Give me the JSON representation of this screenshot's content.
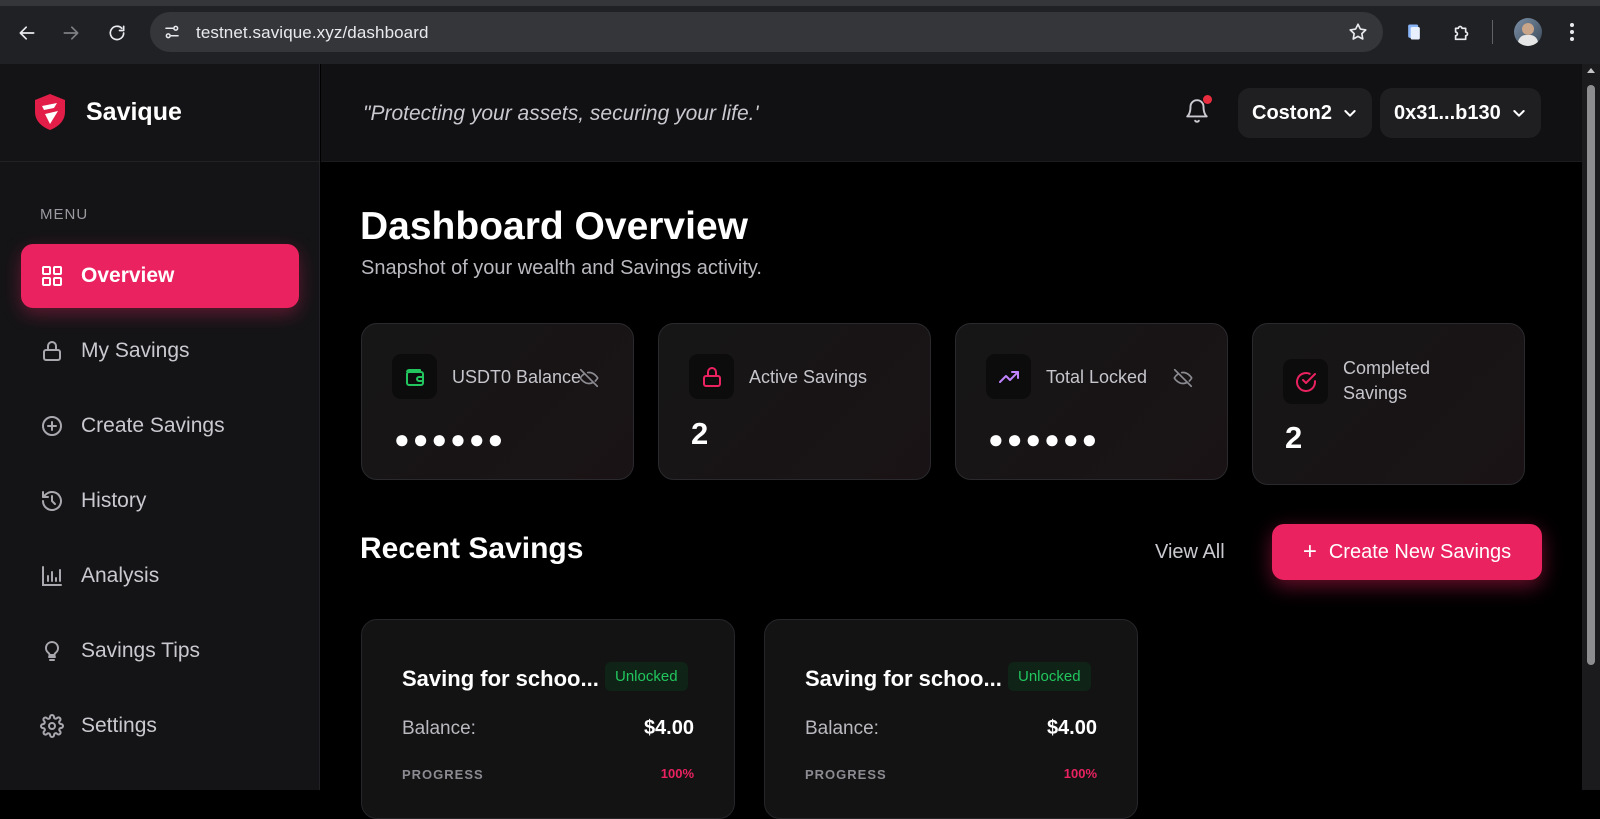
{
  "browser": {
    "url_host": "testnet.savique.xyz",
    "url_path": "/dashboard"
  },
  "brand": {
    "name": "Savique"
  },
  "sidebar": {
    "menu_label": "MENU",
    "items": [
      {
        "label": "Overview",
        "icon": "grid-icon",
        "active": true
      },
      {
        "label": "My Savings",
        "icon": "lock-icon"
      },
      {
        "label": "Create Savings",
        "icon": "plus-circle-icon"
      },
      {
        "label": "History",
        "icon": "history-icon"
      },
      {
        "label": "Analysis",
        "icon": "bar-chart-icon"
      },
      {
        "label": "Savings Tips",
        "icon": "lightbulb-icon"
      },
      {
        "label": "Settings",
        "icon": "gear-icon"
      }
    ]
  },
  "topbar": {
    "tagline": "\"Protecting your assets, securing your life.'",
    "network": "Coston2",
    "wallet": "0x31...b130"
  },
  "main": {
    "title": "Dashboard Overview",
    "subtitle": "Snapshot of your wealth and Savings activity.",
    "stats": [
      {
        "label": "USDT0 Balance",
        "value": "●●●●●●",
        "hidden": true,
        "icon": "wallet-icon",
        "icon_color": "#22c55e"
      },
      {
        "label": "Active Savings",
        "value": "2",
        "icon": "lock-icon",
        "icon_color": "#ea2260"
      },
      {
        "label": "Total Locked",
        "value": "●●●●●●",
        "hidden": true,
        "icon": "trending-up-icon",
        "icon_color": "#c084fc"
      },
      {
        "label_line1": "Completed",
        "label_line2": "Savings",
        "value": "2",
        "icon": "check-circle-icon",
        "icon_color": "#ea2260"
      }
    ],
    "recent": {
      "title": "Recent Savings",
      "view_all": "View All",
      "create_button": "Create New Savings",
      "create_icon": "+",
      "cards": [
        {
          "title": "Saving for schoo...",
          "status": "Unlocked",
          "balance_label": "Balance:",
          "balance": "$4.00",
          "progress_label": "PROGRESS",
          "progress": "100%"
        },
        {
          "title": "Saving for schoo...",
          "status": "Unlocked",
          "balance_label": "Balance:",
          "balance": "$4.00",
          "progress_label": "PROGRESS",
          "progress": "100%"
        }
      ]
    }
  },
  "colors": {
    "accent": "#ea2260",
    "success": "#22c55e",
    "background": "#000000",
    "sidebar": "#141416"
  }
}
